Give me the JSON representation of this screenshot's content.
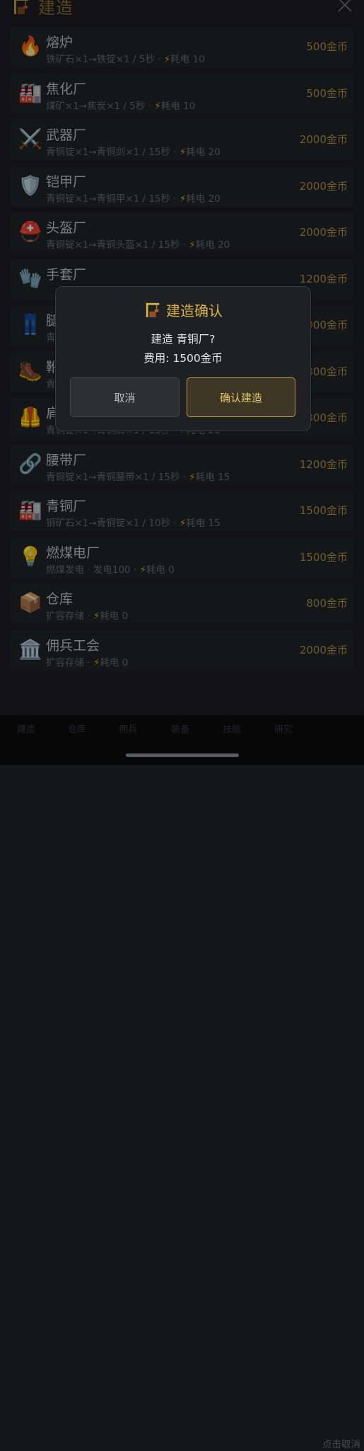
{
  "header": {
    "title": "建造"
  },
  "items": [
    {
      "icon": "fire-icon",
      "emoji": "🔥",
      "name": "熔炉",
      "desc": "铁矿石×1→铁锭×1 / 5秒 · ",
      "power": "耗电 10",
      "price": "500金币"
    },
    {
      "icon": "factory-icon",
      "emoji": "🏭",
      "name": "焦化厂",
      "desc": "煤矿×1→焦炭×1 / 5秒 · ",
      "power": "耗电 10",
      "price": "500金币"
    },
    {
      "icon": "crossed-swords-icon",
      "emoji": "⚔️",
      "name": "武器厂",
      "desc": "青铜锭×1→青铜剑×1 / 15秒 · ",
      "power": "耗电 20",
      "price": "2000金币"
    },
    {
      "icon": "shield-icon",
      "emoji": "🛡️",
      "name": "铠甲厂",
      "desc": "青铜锭×1→青铜甲×1 / 15秒 · ",
      "power": "耗电 20",
      "price": "2000金币"
    },
    {
      "icon": "helmet-icon",
      "emoji": "⛑️",
      "name": "头盔厂",
      "desc": "青铜锭×1→青铜头盔×1 / 15秒 · ",
      "power": "耗电 20",
      "price": "2000金币"
    },
    {
      "icon": "gloves-icon",
      "emoji": "🧤",
      "name": "手套厂",
      "desc": "",
      "power": "",
      "price": "1200金币"
    },
    {
      "icon": "jeans-icon",
      "emoji": "👖",
      "name": "腿",
      "desc": "青",
      "power": "",
      "price": "000金币"
    },
    {
      "icon": "boot-icon",
      "emoji": "🥾",
      "name": "靴",
      "desc": "青",
      "power": "",
      "price": "800金币"
    },
    {
      "icon": "vest-icon",
      "emoji": "🦺",
      "name": "肩",
      "desc": "青铜锭×1→青铜肩×1 / 15秒 · ",
      "power": "耗电 20",
      "price": "800金币"
    },
    {
      "icon": "chain-link-icon",
      "emoji": "🔗",
      "name": "腰带厂",
      "desc": "青铜锭×1→青铜腰带×1 / 15秒 · ",
      "power": "耗电 15",
      "price": "1200金币"
    },
    {
      "icon": "factory-icon",
      "emoji": "🏭",
      "name": "青铜厂",
      "desc": "铜矿石×1→青铜锭×1 / 10秒 · ",
      "power": "耗电 15",
      "price": "1500金币"
    },
    {
      "icon": "light-bulb-icon",
      "emoji": "💡",
      "name": "燃煤电厂",
      "desc": "燃煤发电 · 发电100 · ",
      "power": "耗电 0",
      "price": "1500金币"
    },
    {
      "icon": "package-icon",
      "emoji": "📦",
      "name": "仓库",
      "desc": "扩容存储 · ",
      "power": "耗电 0",
      "price": "800金币"
    },
    {
      "icon": "classical-building-icon",
      "emoji": "🏛️",
      "name": "佣兵工会",
      "desc": "扩容存储 · ",
      "power": "耗电 0",
      "price": "2000金币"
    }
  ],
  "dialog": {
    "title": "建造确认",
    "message": "建造 青铜厂?",
    "cost": "费用: 1500金币",
    "cancel": "取消",
    "confirm": "确认建造"
  },
  "tabbar": {
    "tabs": [
      "建造",
      "仓库",
      "佣兵",
      "装备",
      "技能",
      "研究"
    ],
    "hint": "点击取消"
  },
  "colors": {
    "accent_gold": "#d8b443",
    "price_gold": "#b39652",
    "bolt_yellow": "#d4b531"
  }
}
